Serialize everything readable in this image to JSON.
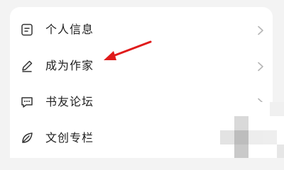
{
  "menu": {
    "items": [
      {
        "label": "个人信息",
        "icon": "document-icon"
      },
      {
        "label": "成为作家",
        "icon": "pen-icon"
      },
      {
        "label": "书友论坛",
        "icon": "chat-icon"
      },
      {
        "label": "文创专栏",
        "icon": "leaf-icon"
      }
    ]
  },
  "annotation": {
    "color": "#e01b1b"
  }
}
